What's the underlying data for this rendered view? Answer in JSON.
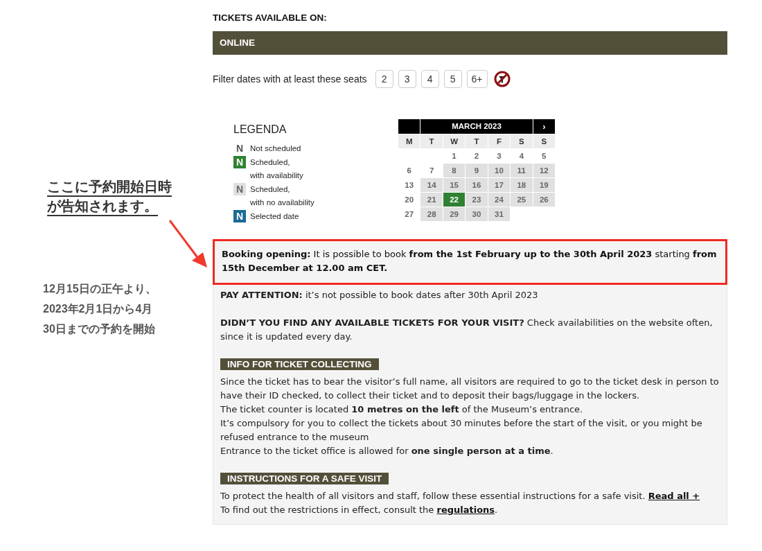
{
  "heading": "TICKETS AVAILABLE ON:",
  "channel_bar": {
    "label": "ONLINE"
  },
  "seat_filter": {
    "label": "Filter dates with at least these seats",
    "options": [
      {
        "label": "2",
        "selected": false
      },
      {
        "label": "3",
        "selected": false
      },
      {
        "label": "4",
        "selected": false
      },
      {
        "label": "5",
        "selected": false
      },
      {
        "label": "6+",
        "selected": false
      }
    ]
  },
  "legend": {
    "title": "LEGENDA",
    "items": [
      {
        "glyph": "N",
        "scheduled": false,
        "selected": false,
        "label": "Not scheduled"
      },
      {
        "glyph": "N",
        "scheduled": true,
        "available": true,
        "selected": false,
        "label": "Scheduled,\nwith availability"
      },
      {
        "glyph": "N",
        "scheduled": true,
        "available": false,
        "selected": false,
        "label": "Scheduled,\nwith no availability"
      },
      {
        "glyph": "N",
        "selected": true,
        "label": "Selected date"
      }
    ]
  },
  "calendar": {
    "month": "MARCH 2023",
    "next": "›",
    "weekdays": [
      "M",
      "T",
      "W",
      "T",
      "F",
      "S",
      "S"
    ],
    "weeks": [
      {
        "days": [
          {
            "label": "1",
            "scheduled": false,
            "selected": false
          },
          {
            "label": "2",
            "scheduled": false,
            "selected": false
          },
          {
            "label": "3",
            "scheduled": false,
            "selected": false
          },
          {
            "label": "4",
            "scheduled": false,
            "selected": false
          },
          {
            "label": "5",
            "scheduled": false,
            "selected": false
          }
        ]
      },
      {
        "days": [
          {
            "label": "6",
            "scheduled": false,
            "selected": false
          },
          {
            "label": "7",
            "scheduled": false,
            "selected": false
          },
          {
            "label": "8",
            "scheduled": true,
            "available": false,
            "selected": false
          },
          {
            "label": "9",
            "scheduled": true,
            "available": false,
            "selected": false
          },
          {
            "label": "10",
            "scheduled": true,
            "available": false,
            "selected": false
          },
          {
            "label": "11",
            "scheduled": true,
            "available": false,
            "selected": false
          },
          {
            "label": "12",
            "scheduled": true,
            "available": false,
            "selected": false
          }
        ]
      },
      {
        "days": [
          {
            "label": "13",
            "scheduled": false,
            "selected": false
          },
          {
            "label": "14",
            "scheduled": true,
            "available": false,
            "selected": false
          },
          {
            "label": "15",
            "scheduled": true,
            "available": false,
            "selected": false
          },
          {
            "label": "16",
            "scheduled": true,
            "available": false,
            "selected": false
          },
          {
            "label": "17",
            "scheduled": true,
            "available": false,
            "selected": false
          },
          {
            "label": "18",
            "scheduled": true,
            "available": false,
            "selected": false
          },
          {
            "label": "19",
            "scheduled": true,
            "available": false,
            "selected": false
          }
        ]
      },
      {
        "days": [
          {
            "label": "20",
            "scheduled": false,
            "selected": false
          },
          {
            "label": "21",
            "scheduled": true,
            "available": false,
            "selected": false
          },
          {
            "label": "22",
            "scheduled": true,
            "available": true,
            "selected": false
          },
          {
            "label": "23",
            "scheduled": true,
            "available": false,
            "selected": false
          },
          {
            "label": "24",
            "scheduled": true,
            "available": false,
            "selected": false
          },
          {
            "label": "25",
            "scheduled": true,
            "available": false,
            "selected": false
          },
          {
            "label": "26",
            "scheduled": true,
            "available": false,
            "selected": false
          }
        ]
      },
      {
        "days": [
          {
            "label": "27",
            "scheduled": false,
            "selected": false
          },
          {
            "label": "28",
            "scheduled": true,
            "available": false,
            "selected": false
          },
          {
            "label": "29",
            "scheduled": true,
            "available": false,
            "selected": false
          },
          {
            "label": "30",
            "scheduled": true,
            "available": false,
            "selected": false
          },
          {
            "label": "31",
            "scheduled": true,
            "available": false,
            "selected": false
          }
        ]
      }
    ]
  },
  "booking_notice": {
    "highlighted": true,
    "text": "**Booking opening:** It is possible to book **from the 1st February up to the 30th April 2023** starting **from 15th December at 12.00 am CET.**"
  },
  "info_blocks": [
    {
      "kind": "paragraph",
      "text": "**PAY ATTENTION:** it’s not possible to book dates after 30th April 2023"
    },
    {
      "kind": "paragraph",
      "text": "**DIDN’T YOU FIND ANY AVAILABLE TICKETS FOR YOUR VISIT?** Check availabilities on the website often, since it is updated every day."
    },
    {
      "kind": "section_title",
      "text": "INFO FOR TICKET COLLECTING"
    },
    {
      "kind": "paragraph",
      "text": "Since the ticket has to bear the visitor’s full name, all visitors are required to go to the ticket desk in person to have their ID checked, to collect their ticket and to deposit their bags/luggage in the lockers.\nThe ticket counter is located **10 metres on the left** of the Museum’s entrance.\nIt’s compulsory for you to collect the tickets about 30 minutes before the start of the visit, or you might be refused entrance to the museum\nEntrance to the ticket office is allowed for **one single person at a time**."
    },
    {
      "kind": "section_title",
      "text": "INSTRUCTIONS FOR A SAFE VISIT"
    },
    {
      "kind": "linked_paragraph",
      "lines": [
        {
          "text": "To protect the health of all visitors and staff, follow these essential instructions for a safe visit. ",
          "link": "Read all +"
        },
        {
          "text": "To find out the restrictions in effect, consult the ",
          "link": "regulations",
          "after": "."
        }
      ]
    }
  ],
  "annotations": {
    "callout_lines": [
      "ここに予約開始日時",
      "が告知されます。"
    ],
    "note_lines": [
      "12月15日の正午より、",
      "2023年2月1日から4月",
      "30日までの予約を開始"
    ]
  }
}
